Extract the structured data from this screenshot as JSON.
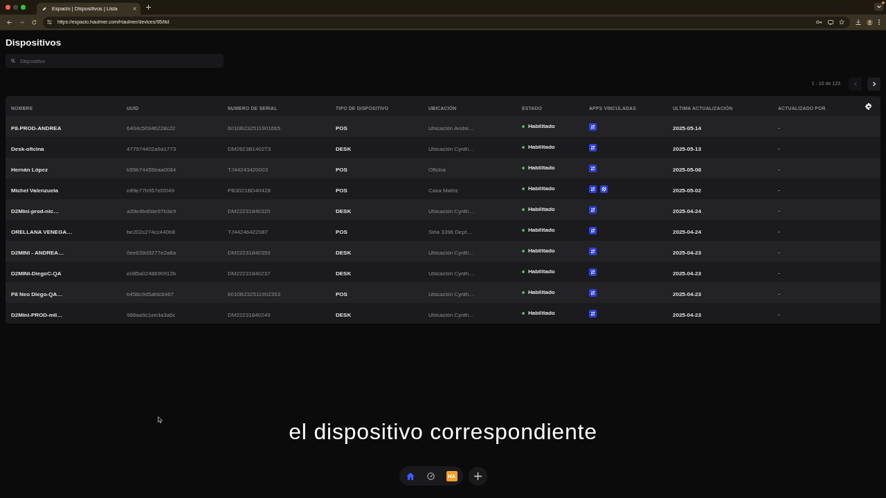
{
  "browser": {
    "tabs": [
      {
        "title": "Espacio | Dispositivos | Lista",
        "selected": true
      }
    ],
    "url": "https://espacio.haulmer.com/Haulmer/devices/95/list"
  },
  "page": {
    "title": "Dispositivos",
    "search": {
      "placeholder": "Dispositivo"
    },
    "pagination": {
      "label": "1 - 10 de 123",
      "prev_disabled": true,
      "next_disabled": false
    }
  },
  "table": {
    "columns": [
      "NOMBRE",
      "UUID",
      "NUMERO DE SERIAL",
      "TIPO DE DISPOSITIVO",
      "UBICACIÓN",
      "ESTADO",
      "APPS VINCULADAS",
      "ULTIMA ACTUALIZACIÓN",
      "ACTUALIZADO POR"
    ],
    "rows": [
      {
        "name": "P8-PROD-ANDREA",
        "uuid": "6404c50946228c22",
        "serial": "6010B232511901665",
        "type": "POS",
        "location": "Ubicación Andre…",
        "status": "Habilitado",
        "apps": [
          {
            "kind": "swap"
          }
        ],
        "updated": "2025-05-14",
        "updated_by": "-"
      },
      {
        "name": "Desk-oficina",
        "uuid": "477974402a9a1773",
        "serial": "DM2623B140273",
        "type": "DESK",
        "location": "Ubicación Cynth…",
        "status": "Habilitado",
        "apps": [
          {
            "kind": "swap"
          }
        ],
        "updated": "2025-05-13",
        "updated_by": "-"
      },
      {
        "name": "Hernán López",
        "uuid": "b55b74455baa0084",
        "serial": "TJ44243420003",
        "type": "POS",
        "location": "Oficina",
        "status": "Habilitado",
        "apps": [
          {
            "kind": "swap"
          }
        ],
        "updated": "2025-05-08",
        "updated_by": "-"
      },
      {
        "name": "Michel Valenzuela",
        "uuid": "e89e77b957ef2049",
        "serial": "PB3021BD40428",
        "type": "POS",
        "location": "Casa Matriz",
        "status": "Habilitado",
        "apps": [
          {
            "kind": "swap"
          },
          {
            "kind": "lines"
          }
        ],
        "updated": "2025-05-02",
        "updated_by": "-"
      },
      {
        "name": "D2Mini-prod-nic…",
        "uuid": "a39e4bd0de97b3e9",
        "serial": "DM22231840320",
        "type": "DESK",
        "location": "Ubicación Cynth…",
        "status": "Habilitado",
        "apps": [
          {
            "kind": "swap"
          }
        ],
        "updated": "2025-04-24",
        "updated_by": "-"
      },
      {
        "name": "ORELLANA VENEGA…",
        "uuid": "be202c274cc440b8",
        "serial": "TJ44246422087",
        "type": "POS",
        "location": "Siria 3396 Dept…",
        "status": "Habilitado",
        "apps": [
          {
            "kind": "swap"
          }
        ],
        "updated": "2025-04-24",
        "updated_by": "-"
      },
      {
        "name": "D2MINI - ANDREA…",
        "uuid": "0ee639d3277e2a8a",
        "serial": "DM22231840359",
        "type": "DESK",
        "location": "Ubicación Cynth…",
        "status": "Habilitado",
        "apps": [
          {
            "kind": "swap"
          }
        ],
        "updated": "2025-04-23",
        "updated_by": "-"
      },
      {
        "name": "D2MINI-DiegoC-QA",
        "uuid": "e085a0248690912b",
        "serial": "DM22231840237",
        "type": "DESK",
        "location": "Ubicación Cynth…",
        "status": "Habilitado",
        "apps": [
          {
            "kind": "swap"
          }
        ],
        "updated": "2025-04-23",
        "updated_by": "-"
      },
      {
        "name": "P8 Neo Diego-QA…",
        "uuid": "b456c9d5afdc6467",
        "serial": "6010B232511902353",
        "type": "POS",
        "location": "Ubicación Cynth…",
        "status": "Habilitado",
        "apps": [
          {
            "kind": "swap"
          }
        ],
        "updated": "2025-04-23",
        "updated_by": "-"
      },
      {
        "name": "D2Mini-PROD-mil…",
        "uuid": "986aa9c1eeda3a6c",
        "serial": "DM22231840249",
        "type": "DESK",
        "location": "Ubicación Cynth…",
        "status": "Habilitado",
        "apps": [
          {
            "kind": "swap"
          }
        ],
        "updated": "2025-04-23",
        "updated_by": "-"
      }
    ]
  },
  "caption": "el dispositivo correspondiente",
  "dock": {
    "items": [
      {
        "kind": "home",
        "selected": true
      },
      {
        "kind": "gauge",
        "selected": false
      },
      {
        "kind": "tile",
        "label": "HA",
        "selected": false
      }
    ]
  }
}
